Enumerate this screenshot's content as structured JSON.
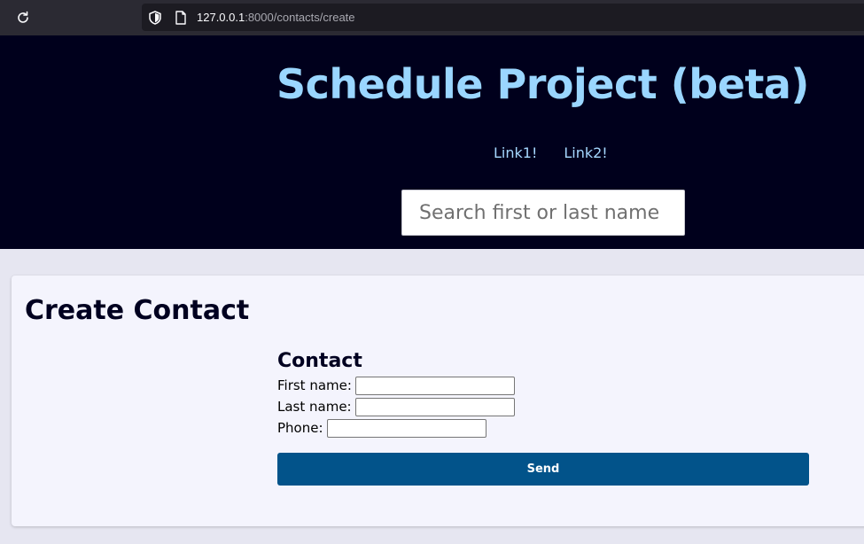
{
  "browser": {
    "url_host": "127.0.0.1",
    "url_rest": ":8000/contacts/create",
    "icons": {
      "reload": "reload-icon",
      "shield": "shield-icon",
      "page": "page-icon"
    }
  },
  "header": {
    "title": "Schedule Project (beta)",
    "links": [
      "Link1!",
      "Link2!"
    ],
    "search_placeholder": "Search first or last name"
  },
  "main": {
    "page_title": "Create Contact",
    "form": {
      "legend": "Contact",
      "fields": [
        {
          "label": "First name:",
          "value": ""
        },
        {
          "label": "Last name:",
          "value": ""
        },
        {
          "label": "Phone:",
          "value": ""
        }
      ],
      "submit_label": "Send"
    }
  },
  "colors": {
    "header_bg": "#00001c",
    "title": "#9ad6ff",
    "button_bg": "#02538a",
    "page_bg": "#e6e6f1",
    "card_bg": "#f4f4fd"
  }
}
